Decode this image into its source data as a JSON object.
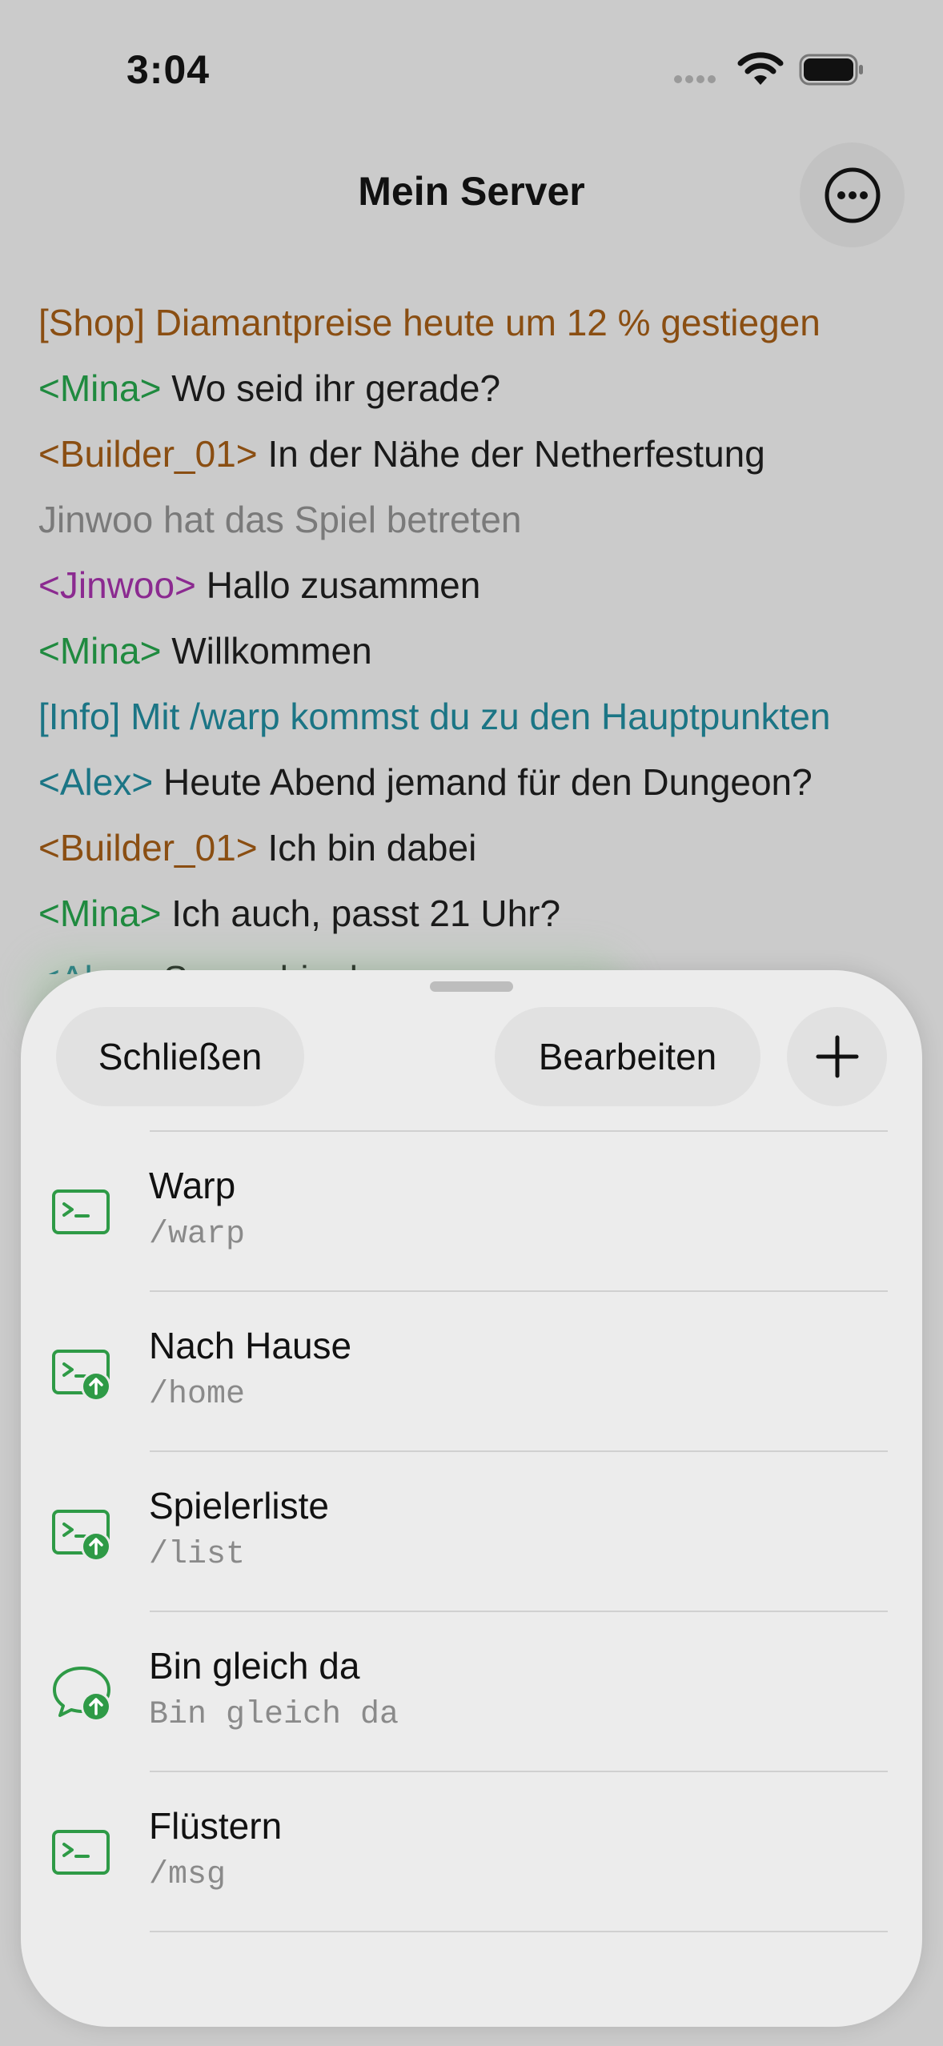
{
  "status": {
    "time": "3:04"
  },
  "header": {
    "title": "Mein Server"
  },
  "chat": {
    "lines": [
      {
        "text": "[Shop] Diamantpreise heute um 12 % gestiegen"
      },
      {
        "sender": "<Mina>",
        "text": "Wo seid ihr gerade?"
      },
      {
        "sender": "<Builder_01>",
        "text": "In der Nähe der Netherfestung"
      },
      {
        "text": "Jinwoo hat das Spiel betreten"
      },
      {
        "sender": "<Jinwoo>",
        "text": "Hallo zusammen"
      },
      {
        "sender": "<Mina>",
        "text": "Willkommen"
      },
      {
        "text": "[Info] Mit /warp kommst du zu den Hauptpunkten"
      },
      {
        "sender": "<Alex>",
        "text": "Heute Abend jemand für den Dungeon?"
      },
      {
        "sender": "<Builder_01>",
        "text": "Ich bin dabei"
      },
      {
        "sender": "<Mina>",
        "text": "Ich auch, passt 21 Uhr?"
      },
      {
        "sender": "<Alex>",
        "text": "Super, bis dann"
      }
    ]
  },
  "sheet": {
    "close_label": "Schließen",
    "edit_label": "Bearbeiten",
    "items": [
      {
        "title": "Warp",
        "command": "/warp",
        "icon": "terminal-icon"
      },
      {
        "title": "Nach Hause",
        "command": "/home",
        "icon": "terminal-upload-icon"
      },
      {
        "title": "Spielerliste",
        "command": "/list",
        "icon": "terminal-upload-icon"
      },
      {
        "title": "Bin gleich da",
        "command": "Bin gleich da",
        "icon": "chat-bubble-upload-icon"
      },
      {
        "title": "Flüstern",
        "command": "/msg",
        "icon": "terminal-icon"
      }
    ]
  },
  "colors": {
    "accent_green": "#2e9a46",
    "shop_orange": "#8a4e12",
    "mina_green": "#1f8a3f",
    "jinwoo_purple": "#8b2a90",
    "info_teal": "#1b7585",
    "system_gray": "#7a7a7a"
  }
}
